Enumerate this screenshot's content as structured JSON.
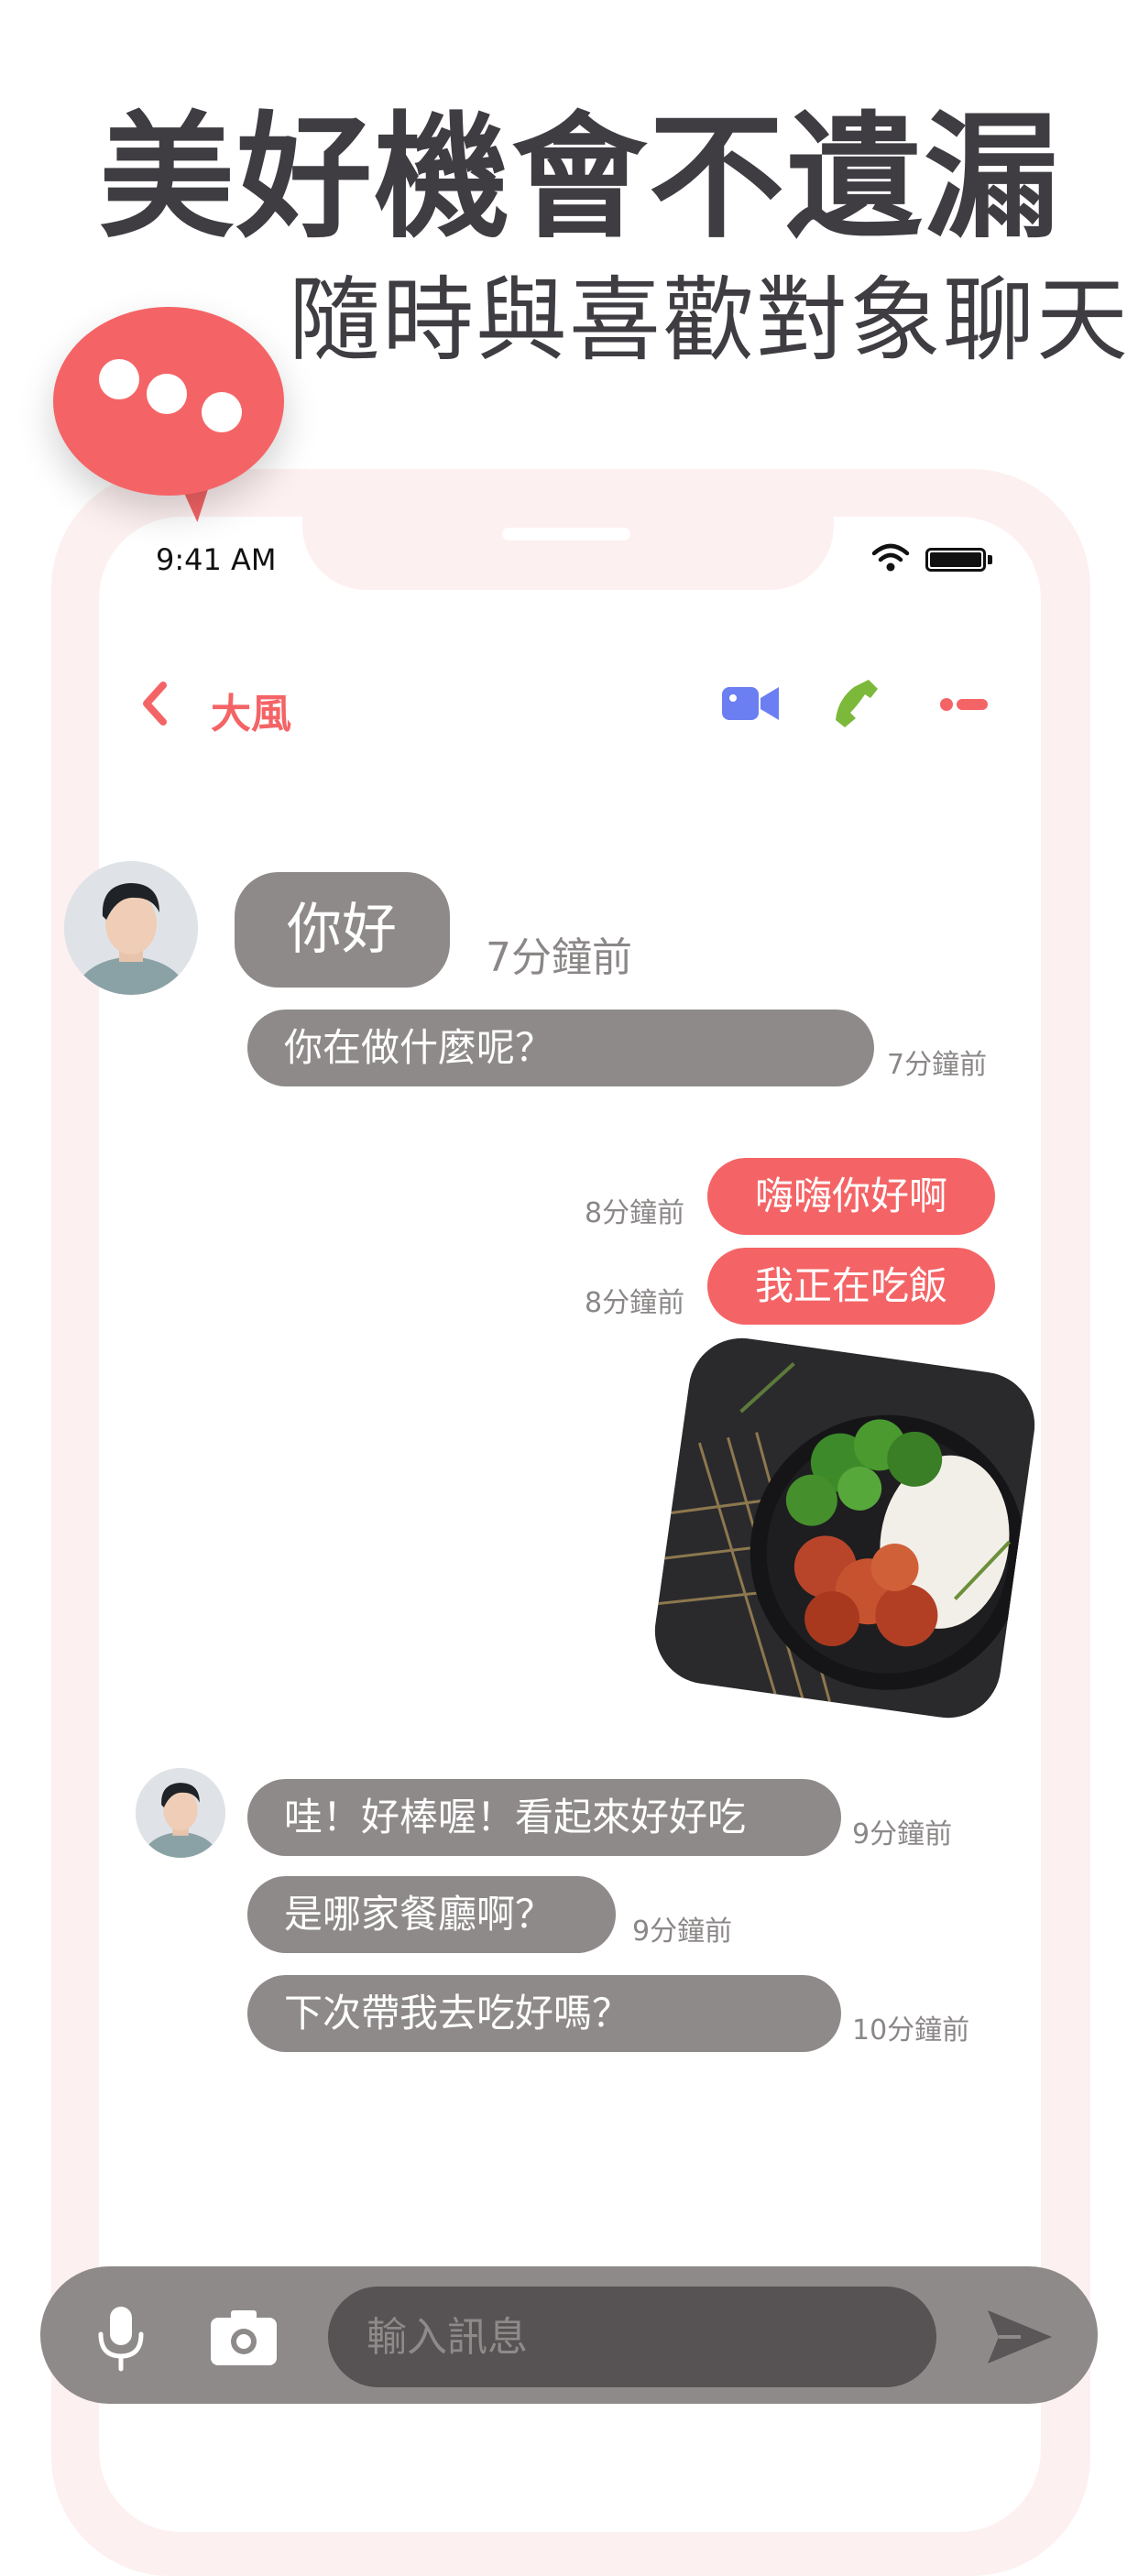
{
  "promo": {
    "headline": "美好機會不遺漏",
    "subline": "隨時與喜歡對象聊天"
  },
  "status_bar": {
    "time": "9:41 AM"
  },
  "chat_header": {
    "contact_name": "大風"
  },
  "messages": [
    {
      "text": "你好",
      "time": "7分鐘前"
    },
    {
      "text": "你在做什麼呢？",
      "time": "7分鐘前"
    },
    {
      "text": "嗨嗨你好啊",
      "time": "8分鐘前"
    },
    {
      "text": "我正在吃飯",
      "time": "8分鐘前"
    },
    {
      "text": "哇！好棒喔！看起來好好吃",
      "time": "9分鐘前"
    },
    {
      "text": "是哪家餐廳啊？",
      "time": "9分鐘前"
    },
    {
      "text": "下次帶我去吃好嗎？",
      "time": "10分鐘前"
    }
  ],
  "composer": {
    "placeholder": "輸入訊息"
  },
  "colors": {
    "accent": "#f46466",
    "incoming_bubble": "#8f8a8a",
    "video_icon": "#6b7ff2",
    "phone_icon": "#7cb83a",
    "text_dark": "#3f3d42"
  },
  "icons": [
    "speech-bubble-logo",
    "back-chevron-icon",
    "video-camera-icon",
    "phone-icon",
    "more-icon",
    "wifi-icon",
    "battery-icon",
    "microphone-icon",
    "camera-icon",
    "send-icon"
  ]
}
